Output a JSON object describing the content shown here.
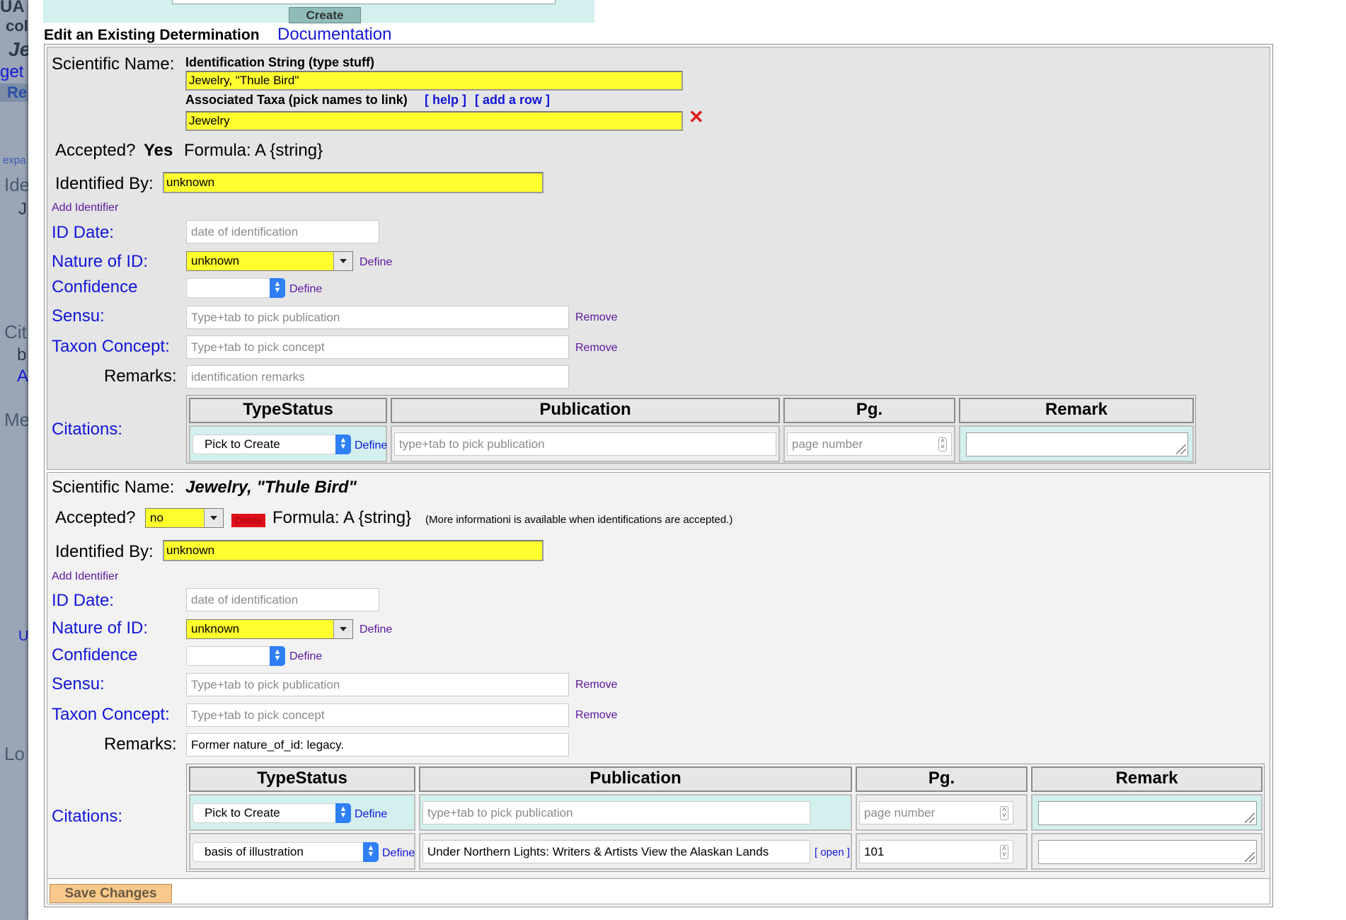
{
  "background": {
    "fragments": [
      "UA",
      "col",
      "Je",
      "get",
      "Re",
      "expa",
      "Ide",
      "J",
      "Cit",
      "b",
      "A",
      "Me",
      "U",
      "Lo"
    ]
  },
  "top": {
    "create_label": "Create"
  },
  "heading": {
    "title": "Edit an Existing Determination",
    "doc_link": "Documentation"
  },
  "det1": {
    "sci_label": "Scientific Name:",
    "id_string_label": "Identification String (type stuff)",
    "id_string_value": "Jewelry, \"Thule Bird\"",
    "assoc_label": "Associated Taxa (pick names to link)",
    "help": "[ help ]",
    "add_row": "[ add a row ]",
    "taxa_value": "Jewelry",
    "accepted_label": "Accepted?",
    "accepted_value": "Yes",
    "formula": "Formula: A {string}",
    "identified_by_label": "Identified By:",
    "identified_by_value": "unknown",
    "add_identifier": "Add Identifier",
    "id_date_label": "ID Date:",
    "id_date_placeholder": "date of identification",
    "nature_label": "Nature of ID:",
    "nature_value": "unknown",
    "define": "Define",
    "confidence_label": "Confidence",
    "sensu_label": "Sensu:",
    "sensu_placeholder": "Type+tab to pick publication",
    "remove": "Remove",
    "taxon_concept_label": "Taxon Concept:",
    "taxon_concept_placeholder": "Type+tab to pick concept",
    "remarks_label": "Remarks:",
    "remarks_placeholder": "identification remarks",
    "citations_label": "Citations:",
    "cit_headers": [
      "TypeStatus",
      "Publication",
      "Pg.",
      "Remark"
    ],
    "cit_row": {
      "typestatus": "Pick to Create",
      "pub_placeholder": "type+tab to pick publication",
      "page_placeholder": "page number"
    }
  },
  "det2": {
    "sci_label": "Scientific Name:",
    "sci_value": "Jewelry, \"Thule Bird\"",
    "accepted_label": "Accepted?",
    "accepted_value": "no",
    "delete": "Delete",
    "formula": "Formula: A {string}",
    "note": "(More informationi is available when identifications are accepted.)",
    "identified_by_label": "Identified By:",
    "identified_by_value": "unknown",
    "add_identifier": "Add Identifier",
    "id_date_label": "ID Date:",
    "id_date_placeholder": "date of identification",
    "nature_label": "Nature of ID:",
    "nature_value": "unknown",
    "define": "Define",
    "confidence_label": "Confidence",
    "sensu_label": "Sensu:",
    "sensu_placeholder": "Type+tab to pick publication",
    "remove": "Remove",
    "taxon_concept_label": "Taxon Concept:",
    "taxon_concept_placeholder": "Type+tab to pick concept",
    "remarks_label": "Remarks:",
    "remarks_value": "Former nature_of_id: legacy.",
    "citations_label": "Citations:",
    "cit_headers": [
      "TypeStatus",
      "Publication",
      "Pg.",
      "Remark"
    ],
    "cit_rows": [
      {
        "typestatus": "Pick to Create",
        "pub_placeholder": "type+tab to pick publication",
        "page_placeholder": "page number"
      },
      {
        "typestatus": "basis of illustration",
        "pub_value": "Under Northern Lights: Writers & Artists View the Alaskan Lands",
        "open": "[ open ]",
        "page_value": "101"
      }
    ]
  },
  "footer": {
    "save_label": "Save Changes"
  }
}
